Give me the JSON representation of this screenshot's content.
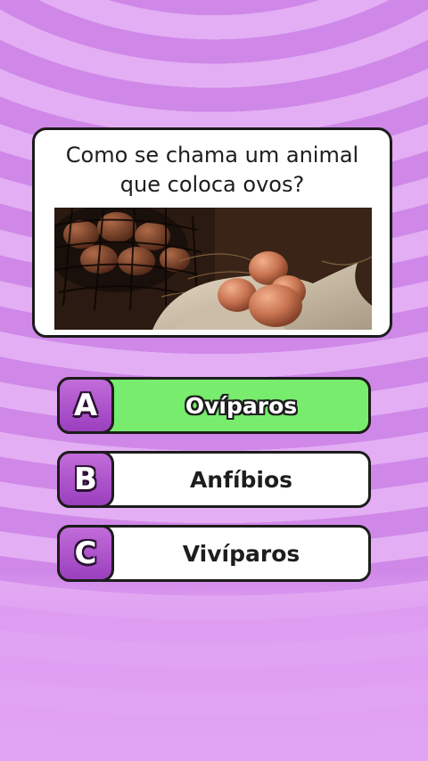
{
  "quiz": {
    "question_line1": "Como se chama um animal",
    "question_line2": "que coloca ovos?",
    "image_subject": "eggs-in-basket",
    "answers": [
      {
        "letter": "A",
        "text": "Ovíparos",
        "state": "correct"
      },
      {
        "letter": "B",
        "text": "Anfíbios",
        "state": "neutral"
      },
      {
        "letter": "C",
        "text": "Vivíparos",
        "state": "neutral"
      }
    ]
  },
  "colors": {
    "background_light": "#e3aef3",
    "background_dark": "#cf88e8",
    "correct_green": "#78ec6d",
    "letter_purple": "#b058d0",
    "outline": "#1c1c1c"
  }
}
